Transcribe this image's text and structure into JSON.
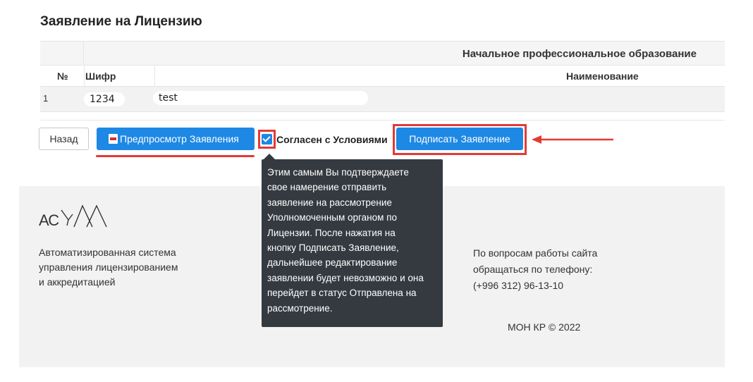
{
  "page": {
    "title": "Заявление на Лицензию"
  },
  "table": {
    "group_header": "Начальное профессиональное образование",
    "columns": {
      "no": "№",
      "code": "Шифр",
      "name": "Наименование"
    },
    "rows": [
      {
        "no": "1",
        "code": "1234",
        "name": "test"
      }
    ]
  },
  "actions": {
    "back_label": "Назад",
    "preview_label": "Предпросмотр Заявления",
    "agree_label": "Согласен с Условиями",
    "agree_checked": true,
    "sign_label": "Подписать Заявление"
  },
  "tooltip": {
    "lines": [
      "Этим самым Вы подтверждаете",
      "свое намерение отправить",
      "заявление на рассмотрение",
      "Уполномоченным органом по",
      "Лицензии. После нажатия на",
      "кнопку Подписать Заявление,",
      "дальнейшее редактирование",
      "заявлении будет невозможно и она",
      "перейдет в статус Отправлена на",
      "рассмотрение."
    ]
  },
  "footer": {
    "logo_text": "АСУЛА",
    "description_lines": [
      "Автоматизированная система",
      "управления лицензированием",
      "и аккредитацией"
    ],
    "contact_lines": [
      "По вопросам работы сайта",
      "обращаться по телефону:",
      "(+996 312) 96-13-10"
    ],
    "copyright": "МОН КР © 2022"
  },
  "colors": {
    "primary": "#1e88e5",
    "highlight": "#e53935",
    "tooltip_bg": "#343a40",
    "footer_bg": "#f2f2f2"
  },
  "icons": {
    "preview": "pdf-icon",
    "agree": "checkbox-checked-icon",
    "annotation": "red-arrow-icon"
  }
}
